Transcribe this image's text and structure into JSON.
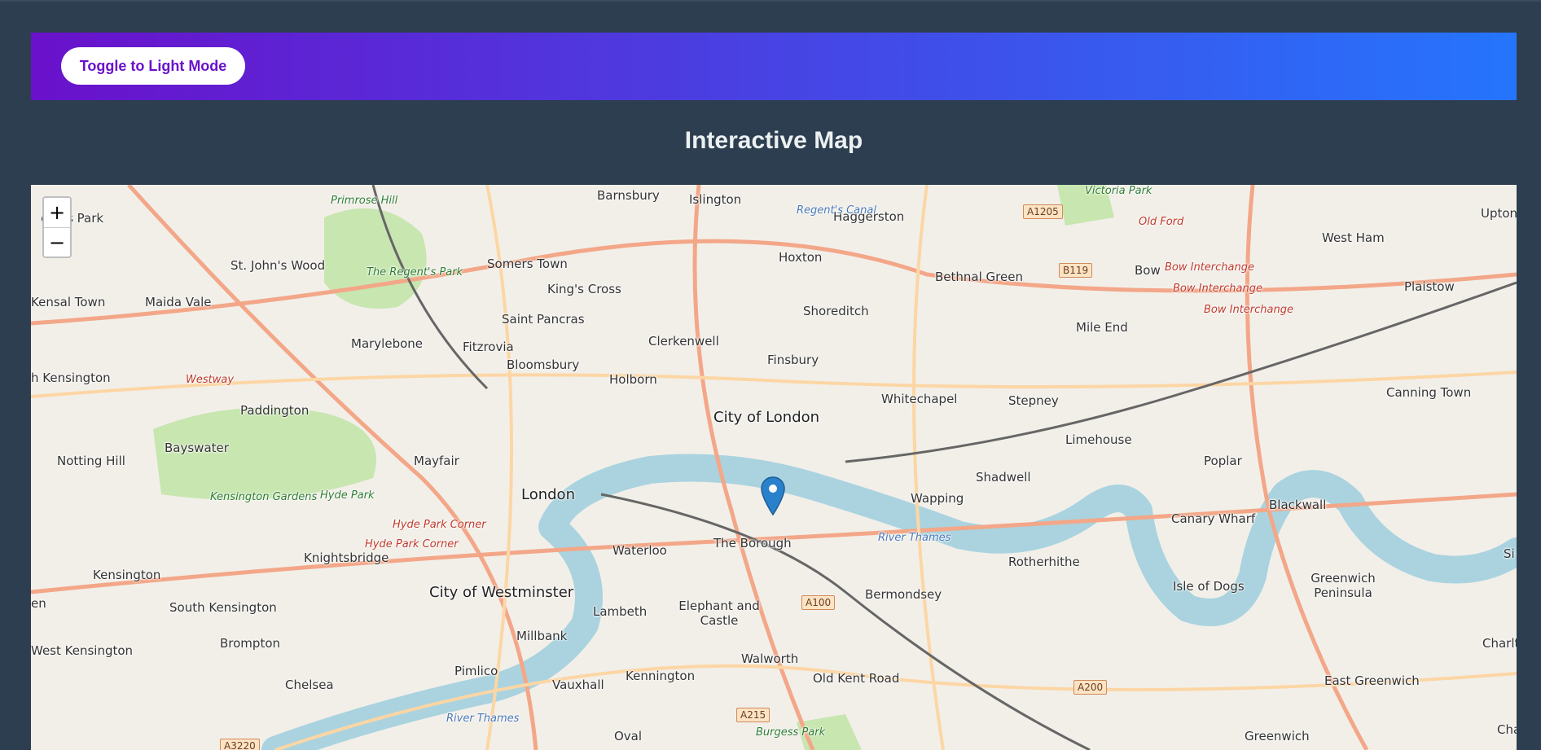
{
  "header": {
    "toggle_label": "Toggle to Light Mode"
  },
  "page": {
    "title": "Interactive Map"
  },
  "map": {
    "zoom_in": "+",
    "zoom_out": "−",
    "place_labels": [
      "Barnsbury",
      "Islington",
      "Haggerston",
      "Hoxton",
      "Bethnal Green",
      "Bow",
      "West Ham",
      "Upton",
      "Somers Town",
      "King's Cross",
      "Shoreditch",
      "Saint Pancras",
      "Clerkenwell",
      "Finsbury",
      "Mile End",
      "Plaistow",
      "St. John's Wood",
      "Maida Vale",
      "Kensal Town",
      "Marylebone",
      "Fitzrovia",
      "Bloomsbury",
      "Holborn",
      "Whitechapel",
      "Stepney",
      "Canning Town",
      "Paddington",
      "City of London",
      "Limehouse",
      "Poplar",
      "Bayswater",
      "Notting Hill",
      "Mayfair",
      "London",
      "Shadwell",
      "Wapping",
      "Blackwall",
      "Canary Wharf",
      "The Borough",
      "Waterloo",
      "Rotherhithe",
      "Knightsbridge",
      "Kensington",
      "City of Westminster",
      "Lambeth",
      "Elephant and Castle",
      "Bermondsey",
      "Isle of Dogs",
      "Greenwich Peninsula",
      "South Kensington",
      "Millbank",
      "Brompton",
      "West Kensington",
      "Walworth",
      "Pimlico",
      "Chelsea",
      "Kennington",
      "Old Kent Road",
      "Vauxhall",
      "East Greenwich",
      "Oval",
      "Greenwich",
      "Primrose Hill",
      "The Regent's Park",
      "Hyde Park",
      "Kensington Gardens",
      "Victoria Park",
      "Burgess Park",
      "een's Park",
      "h Kensington",
      "Charlt",
      "en",
      "Cha",
      "Si"
    ],
    "red_labels": [
      "Old Ford",
      "Bow Interchange",
      "Hyde Park Corner",
      "Westway"
    ],
    "water_labels": [
      "River Thames",
      "Regent's Canal"
    ],
    "road_shields": [
      "A1205",
      "B119",
      "A100",
      "A200",
      "A215",
      "A3220"
    ]
  }
}
